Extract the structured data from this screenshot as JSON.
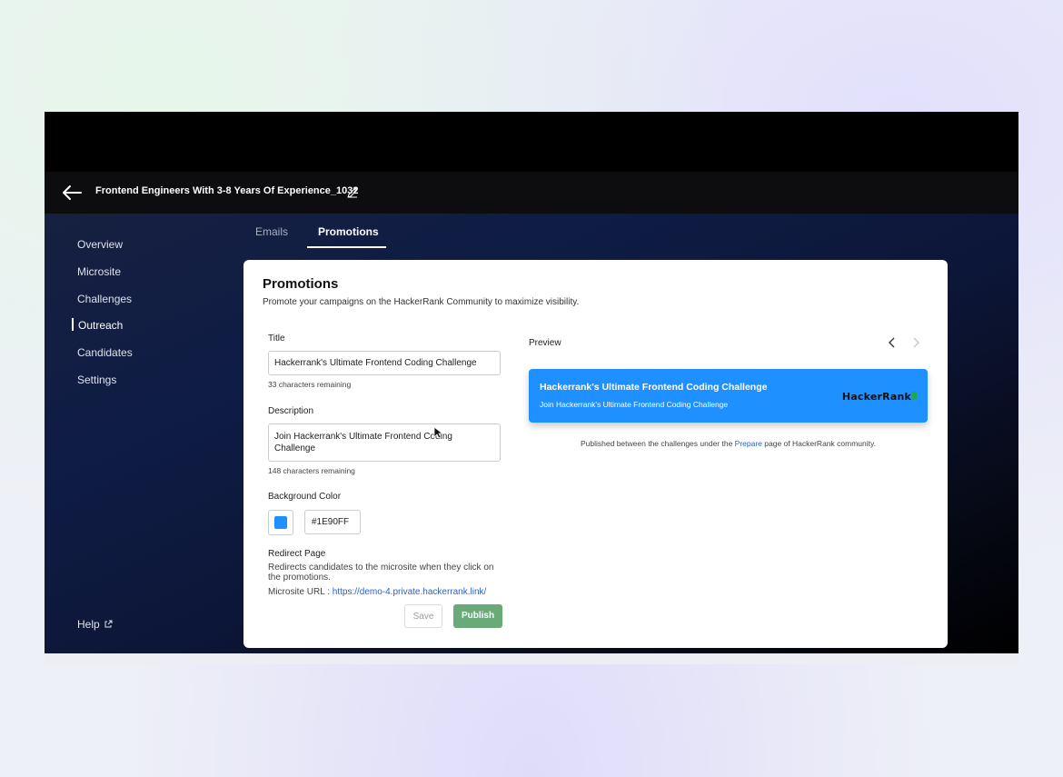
{
  "header": {
    "title": "Frontend Engineers With 3-8 Years Of Experience_1032"
  },
  "sidebar": {
    "items": [
      {
        "label": "Overview"
      },
      {
        "label": "Microsite"
      },
      {
        "label": "Challenges"
      },
      {
        "label": "Outreach"
      },
      {
        "label": "Candidates"
      },
      {
        "label": "Settings"
      }
    ],
    "active_item": "Outreach",
    "help_label": "Help"
  },
  "tabs": [
    {
      "label": "Emails"
    },
    {
      "label": "Promotions"
    }
  ],
  "active_tab": "Promotions",
  "promotions": {
    "heading": "Promotions",
    "subtitle": "Promote your campaigns on the HackerRank Community to maximize visibility.",
    "title_label": "Title",
    "title_value": "Hackerrank's Ultimate Frontend Coding Challenge",
    "title_hint": "33 characters remaining",
    "description_label": "Description",
    "description_value": "Join Hackerrank's Ultimate Frontend Coding Challenge",
    "description_hint": "148 characters remaining",
    "bg_color_label": "Background Color",
    "bg_color_value": "#1E90FF",
    "redirect_label": "Redirect Page",
    "redirect_desc": "Redirects candidates to the microsite when they click on the promotions.",
    "microsite_url_label": "Microsite URL :",
    "microsite_url_value": "https://demo-4.private.hackerrank.link/",
    "save_label": "Save",
    "publish_label": "Publish"
  },
  "preview": {
    "label": "Preview",
    "card_title": "Hackerrank's Ultimate Frontend Coding Challenge",
    "card_desc": "Join Hackerrank's Ultimate Frontend Coding Challenge",
    "logo_text": "HackerRank",
    "caption_before": "Published between the challenges under the ",
    "caption_link": "Prepare",
    "caption_after": " page of HackerRank community."
  },
  "colors": {
    "promo_bg": "#1E90FF",
    "publish_bg": "#6aaa78",
    "logo_accent": "#1ba94c"
  },
  "icons": {
    "back": "back-arrow-icon",
    "edit": "pencil-icon",
    "help_external": "external-link-icon",
    "prev": "chevron-left-icon",
    "next": "chevron-right-icon"
  }
}
